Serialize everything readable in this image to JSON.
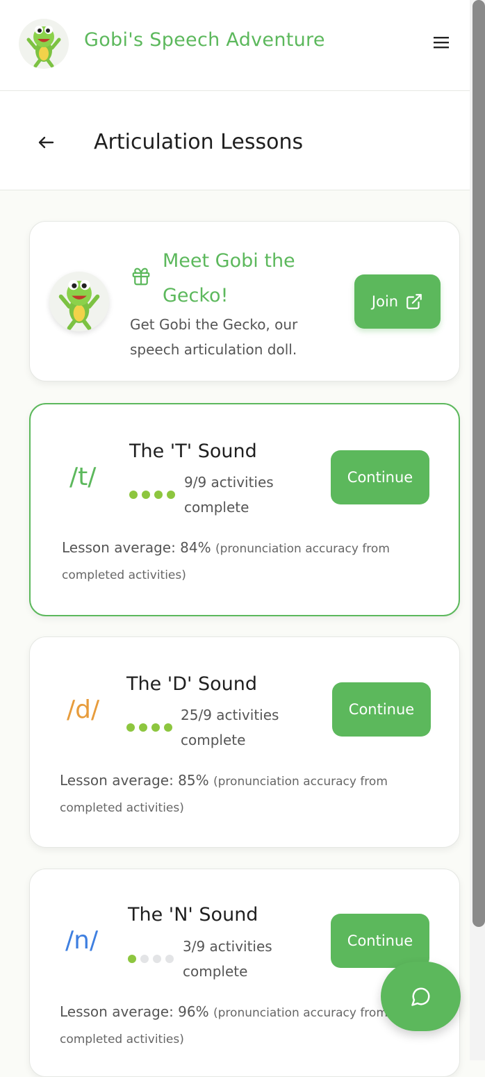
{
  "app": {
    "title": "Gobi's Speech Adventure",
    "logo_icon": "gecko-mascot"
  },
  "header": {
    "menu_icon": "hamburger-menu-icon"
  },
  "subheader": {
    "back_icon": "arrow-left-icon",
    "title": "Articulation Lessons"
  },
  "promo": {
    "icon": "gift-icon",
    "title": "Meet Gobi the Gecko!",
    "description": "Get Gobi the Gecko, our speech articulation doll.",
    "button_label": "Join",
    "button_icon": "external-link-icon"
  },
  "lessons": [
    {
      "symbol": "/t/",
      "symbol_color": "#5cb85c",
      "title": "The 'T' Sound",
      "progress_text": "9/9 activities complete",
      "progress_fraction": 1.0,
      "dots": [
        true,
        true,
        true,
        true
      ],
      "button_label": "Continue",
      "average_label": "Lesson average: 84%",
      "average_note": "(pronunciation accuracy from completed activities)",
      "highlighted": true
    },
    {
      "symbol": "/d/",
      "symbol_color": "#e79c3c",
      "title": "The 'D' Sound",
      "progress_text": "25/9 activities complete",
      "progress_fraction": 1.0,
      "dots": [
        true,
        true,
        true,
        true
      ],
      "button_label": "Continue",
      "average_label": "Lesson average: 85%",
      "average_note": "(pronunciation accuracy from completed activities)",
      "highlighted": false
    },
    {
      "symbol": "/n/",
      "symbol_color": "#3e7fe0",
      "title": "The 'N' Sound",
      "progress_text": "3/9 activities complete",
      "progress_fraction": 0.33,
      "dots": [
        true,
        false,
        false,
        false
      ],
      "button_label": "Continue",
      "average_label": "Lesson average: 96%",
      "average_note": "(pronunciation accuracy from completed activities)",
      "highlighted": false
    }
  ],
  "chat": {
    "icon": "chat-bubble-icon"
  },
  "colors": {
    "accent": "#5cb85c",
    "dot_on": "#8dc63f",
    "dot_off": "#e3e4e6"
  }
}
